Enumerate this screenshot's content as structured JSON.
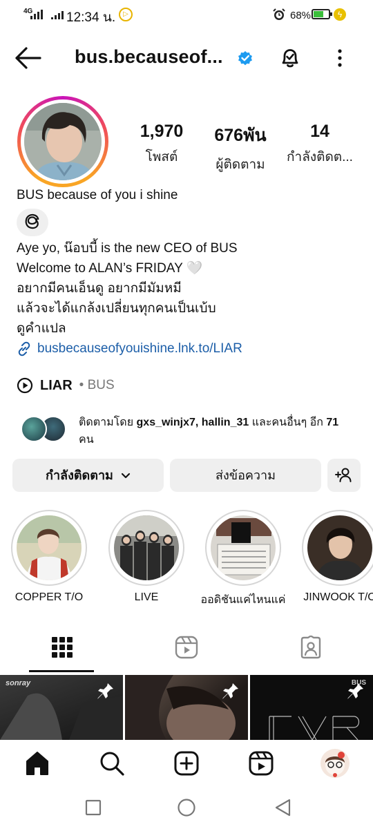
{
  "status_bar": {
    "network": "4G",
    "time": "12:34 น.",
    "battery_percent": "68%",
    "battery_level": 0.68
  },
  "header": {
    "username": "bus.becauseof...",
    "verified": true
  },
  "profile": {
    "stats": [
      {
        "value": "1,970",
        "label": "โพสต์"
      },
      {
        "value": "676พัน",
        "label": "ผู้ติดตาม"
      },
      {
        "value": "14",
        "label": "กำลังติดต..."
      }
    ],
    "display_name": "BUS because of you i shine",
    "bio_lines": [
      "Aye yo, น๊อบบี้ is the new CEO of BUS",
      "Welcome to ALAN’s FRIDAY 🤍",
      "อยากมีคนเอ็นดู อยากมีมัมหมี",
      "แล้วจะได้แกล้งเปลี่ยนทุกคนเป็นเบ้บ",
      "ดูคำแปล"
    ],
    "link": "busbecauseofyouishine.lnk.to/LIAR",
    "music_title": "LIAR",
    "music_artist": "• BUS",
    "followed_by_prefix": "ติดตามโดย ",
    "followed_by_names": "gxs_winjx7, hallin_31",
    "followed_by_suffix": " และคนอื่นๆ อีก ",
    "followed_by_count": "71",
    "followed_by_unit": "คน"
  },
  "actions": {
    "following_label": "กำลังติดตาม",
    "message_label": "ส่งข้อความ"
  },
  "highlights": [
    {
      "label": "COPPER T/O"
    },
    {
      "label": "LIVE"
    },
    {
      "label": "ออดิชันแค่ไหนแค่"
    },
    {
      "label": "JINWOOK T/O"
    }
  ],
  "tabs": [
    {
      "name": "grid-icon",
      "active": true
    },
    {
      "name": "reels-icon",
      "active": false
    },
    {
      "name": "tagged-icon",
      "active": false
    }
  ],
  "grid_posts": [
    {
      "overlay_text": "sonray",
      "pinned": true
    },
    {
      "overlay_text": "",
      "pinned": true
    },
    {
      "overlay_text": "BUS",
      "pinned": true
    }
  ],
  "colors": {
    "link": "#1c5ea8",
    "verified": "#1d9bf0",
    "button_bg": "#efefef"
  }
}
